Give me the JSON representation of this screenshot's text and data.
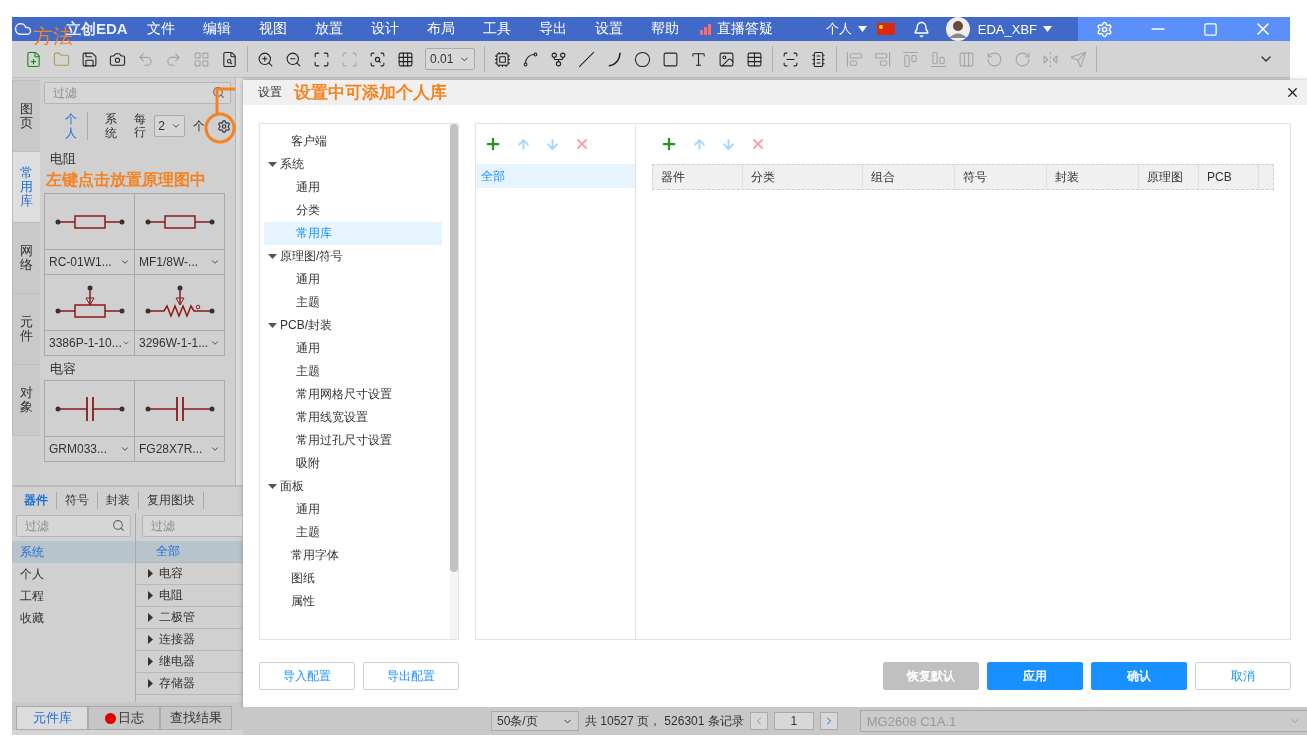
{
  "annotations": {
    "method": "方法",
    "settings_note": "设置中可添加个人库",
    "place_note": "左键点击放置原理图中"
  },
  "app": {
    "logo": "立创EDA",
    "menu": [
      "文件",
      "编辑",
      "视图",
      "放置",
      "设计",
      "布局",
      "工具",
      "导出",
      "设置",
      "帮助"
    ],
    "live": "直播答疑",
    "account_menu": "个人",
    "user": "EDA_XBF"
  },
  "toolbar": {
    "groups": [
      [
        {
          "kind": "new",
          "disabled": false
        },
        {
          "kind": "open",
          "disabled": false
        },
        {
          "kind": "save",
          "disabled": false
        },
        {
          "kind": "snapshot",
          "disabled": false
        },
        {
          "kind": "undo",
          "disabled": true
        },
        {
          "kind": "redo",
          "disabled": true
        },
        {
          "kind": "group",
          "disabled": true
        },
        {
          "kind": "find",
          "disabled": false
        }
      ],
      [
        {
          "kind": "zoom-in",
          "disabled": false
        },
        {
          "kind": "zoom-out",
          "disabled": false
        },
        {
          "kind": "fit",
          "disabled": false
        },
        {
          "kind": "zoom-area",
          "disabled": true
        },
        {
          "kind": "zoom-select",
          "disabled": false
        },
        {
          "kind": "grid",
          "disabled": false
        }
      ],
      [
        {
          "kind": "chip",
          "disabled": false
        },
        {
          "kind": "wire",
          "disabled": false
        },
        {
          "kind": "net",
          "disabled": false
        },
        {
          "kind": "line",
          "disabled": false
        },
        {
          "kind": "arc",
          "disabled": false
        },
        {
          "kind": "circle",
          "disabled": false
        },
        {
          "kind": "rect",
          "disabled": false
        },
        {
          "kind": "text",
          "disabled": false
        },
        {
          "kind": "image",
          "disabled": false
        },
        {
          "kind": "table",
          "disabled": false
        }
      ],
      [
        {
          "kind": "board",
          "disabled": false
        },
        {
          "kind": "convert",
          "disabled": false
        }
      ],
      [
        {
          "kind": "align-left",
          "disabled": true
        },
        {
          "kind": "align-right",
          "disabled": true
        },
        {
          "kind": "align-top",
          "disabled": true
        },
        {
          "kind": "align-bottom",
          "disabled": true
        },
        {
          "kind": "distribute",
          "disabled": true
        },
        {
          "kind": "rotate-left",
          "disabled": true
        },
        {
          "kind": "rotate-right",
          "disabled": true
        },
        {
          "kind": "flip",
          "disabled": true
        },
        {
          "kind": "mirror",
          "disabled": true
        }
      ]
    ],
    "grid_value": "0.01"
  },
  "side_tabs": [
    {
      "label": "图页",
      "selected": false
    },
    {
      "label": "常用库",
      "selected": true
    },
    {
      "label": "网络",
      "selected": false
    },
    {
      "label": "元件",
      "selected": false
    },
    {
      "label": "对象",
      "selected": false
    }
  ],
  "library": {
    "filter_placeholder": "过滤",
    "scopes": [
      {
        "label": "个人",
        "selected": true
      },
      {
        "label": "系统",
        "selected": false
      }
    ],
    "per_row_label": "每行",
    "per_row": "2",
    "unit": "个",
    "groups": [
      {
        "title": "电阻",
        "items": [
          {
            "name": "RC-01W1...",
            "kind": "resistor"
          },
          {
            "name": "MF1/8W-...",
            "kind": "resistor"
          },
          {
            "name": "3386P-1-10...",
            "kind": "potentiometer"
          },
          {
            "name": "3296W-1-1...",
            "kind": "trimmer"
          }
        ]
      },
      {
        "title": "电容",
        "items": [
          {
            "name": "GRM033...",
            "kind": "capacitor"
          },
          {
            "name": "FG28X7R...",
            "kind": "capacitor"
          }
        ]
      }
    ]
  },
  "bottom_tabs": [
    {
      "label": "器件",
      "selected": true
    },
    {
      "label": "符号",
      "selected": false
    },
    {
      "label": "封装",
      "selected": false
    },
    {
      "label": "复用图块",
      "selected": false
    }
  ],
  "sources": {
    "filter_placeholder": "过滤",
    "items": [
      {
        "label": "系统",
        "selected": true
      },
      {
        "label": "个人",
        "selected": false
      },
      {
        "label": "工程",
        "selected": false
      },
      {
        "label": "收藏",
        "selected": false
      }
    ]
  },
  "categories": {
    "filter_placeholder": "过滤",
    "items": [
      {
        "label": "全部",
        "selected": true
      },
      {
        "label": "电容",
        "selected": false,
        "expanded": false
      },
      {
        "label": "电阻",
        "selected": false,
        "expanded": false
      },
      {
        "label": "二极管",
        "selected": false,
        "expanded": false
      },
      {
        "label": "连接器",
        "selected": false,
        "expanded": false
      },
      {
        "label": "继电器",
        "selected": false,
        "expanded": false
      },
      {
        "label": "存储器",
        "selected": false,
        "expanded": false
      }
    ]
  },
  "panel_tabs": [
    {
      "label": "元件库",
      "selected": true,
      "alert": false
    },
    {
      "label": "日志",
      "selected": false,
      "alert": true
    },
    {
      "label": "查找结果",
      "selected": false,
      "alert": false
    }
  ],
  "pager": {
    "page_size": "50条/页",
    "summary": "共 10527 页， 526301 条记录",
    "page": "1"
  },
  "search_value": "MG2608 C1A.1",
  "dialog": {
    "title": "设置",
    "tree": [
      {
        "label": "客户端",
        "selected": false
      },
      {
        "label": "系统",
        "selected": false,
        "expanded": true,
        "children": [
          {
            "label": "通用",
            "selected": false
          },
          {
            "label": "分类",
            "selected": false
          },
          {
            "label": "常用库",
            "selected": true
          }
        ]
      },
      {
        "label": "原理图/符号",
        "selected": false,
        "expanded": true,
        "children": [
          {
            "label": "通用",
            "selected": false
          },
          {
            "label": "主题",
            "selected": false
          }
        ]
      },
      {
        "label": "PCB/封装",
        "selected": false,
        "expanded": true,
        "children": [
          {
            "label": "通用",
            "selected": false
          },
          {
            "label": "主题",
            "selected": false
          },
          {
            "label": "常用网格尺寸设置",
            "selected": false
          },
          {
            "label": "常用线宽设置",
            "selected": false
          },
          {
            "label": "常用过孔尺寸设置",
            "selected": false
          },
          {
            "label": "吸附",
            "selected": false
          }
        ]
      },
      {
        "label": "面板",
        "selected": false,
        "expanded": true,
        "children": [
          {
            "label": "通用",
            "selected": false
          },
          {
            "label": "主题",
            "selected": false
          }
        ]
      },
      {
        "label": "常用字体",
        "selected": false
      },
      {
        "label": "图纸",
        "selected": false
      },
      {
        "label": "属性",
        "selected": false
      }
    ],
    "groups": [
      {
        "label": "全部",
        "selected": true
      }
    ],
    "columns": [
      "器件",
      "分类",
      "组合",
      "符号",
      "封装",
      "原理图",
      "PCB"
    ],
    "left_buttons": [
      {
        "label": "导入配置",
        "kind": "outline",
        "disabled": false
      },
      {
        "label": "导出配置",
        "kind": "outline",
        "disabled": false
      }
    ],
    "right_buttons": [
      {
        "label": "恢复默认",
        "kind": "primary",
        "disabled": true
      },
      {
        "label": "应用",
        "kind": "primary",
        "disabled": false
      },
      {
        "label": "确认",
        "kind": "primary",
        "disabled": false
      },
      {
        "label": "取消",
        "kind": "outline",
        "disabled": false
      }
    ]
  }
}
